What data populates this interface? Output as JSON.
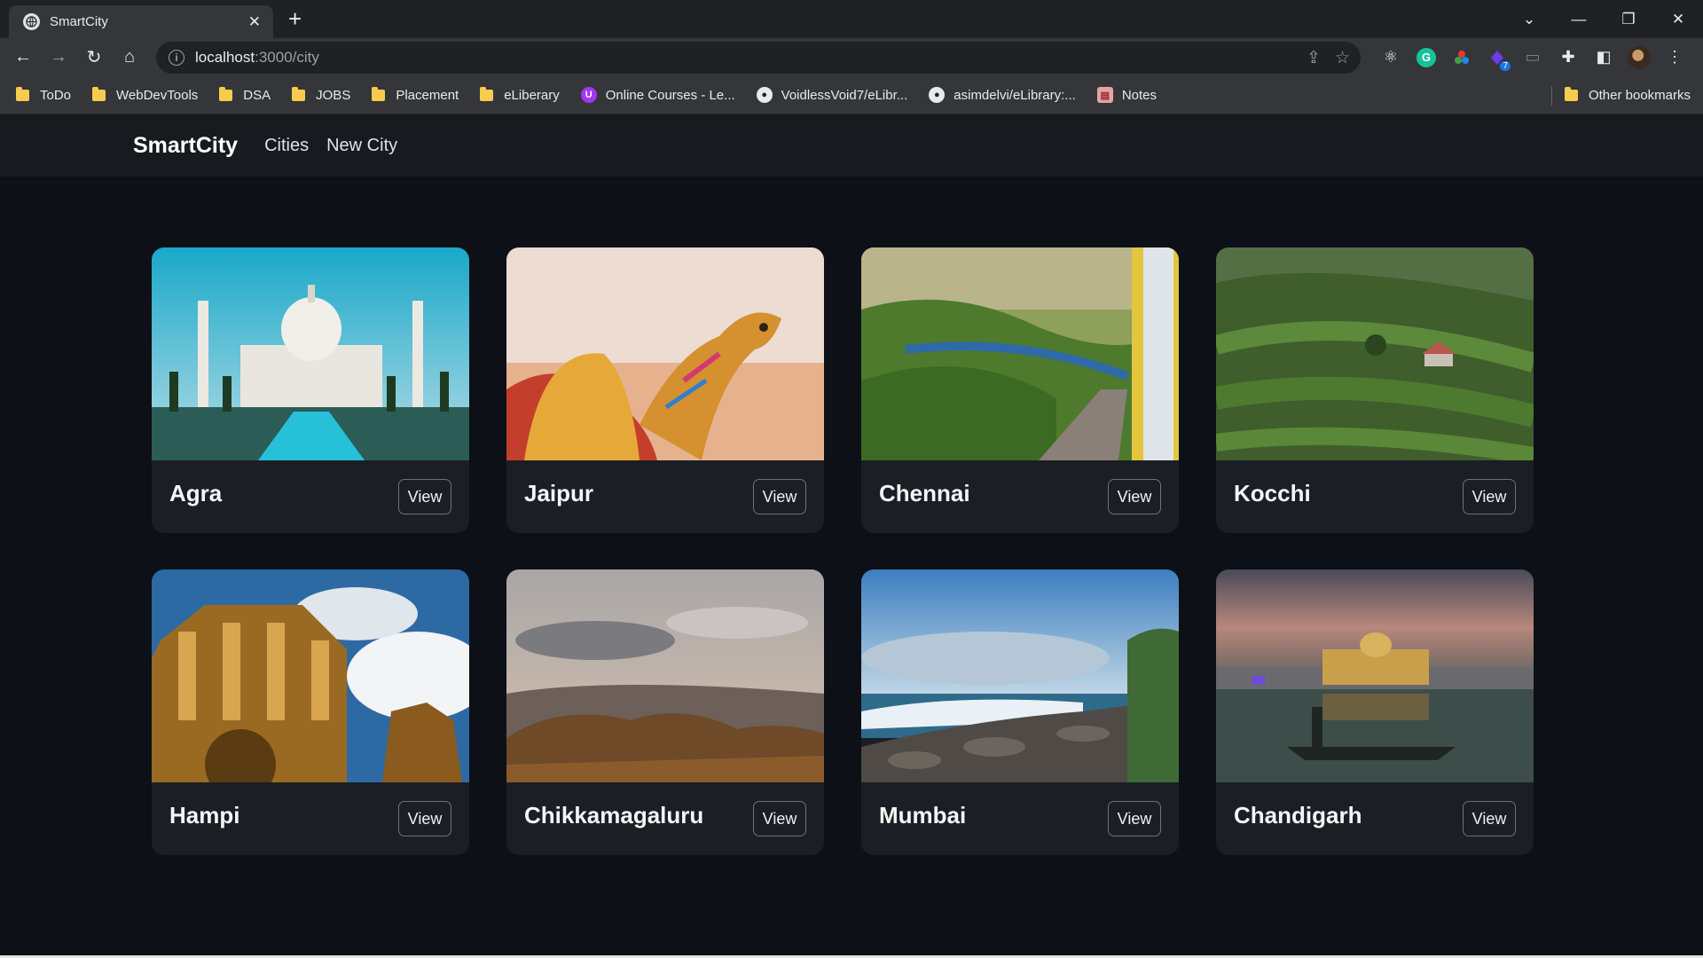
{
  "browser": {
    "tab_title": "SmartCity",
    "url_host": "localhost",
    "url_path": ":3000/city",
    "bookmarks": [
      {
        "label": "ToDo",
        "icon": "folder-icon"
      },
      {
        "label": "WebDevTools",
        "icon": "folder-icon"
      },
      {
        "label": "DSA",
        "icon": "folder-icon"
      },
      {
        "label": "JOBS",
        "icon": "folder-icon"
      },
      {
        "label": "Placement",
        "icon": "folder-icon"
      },
      {
        "label": "eLiberary",
        "icon": "folder-icon"
      },
      {
        "label": "Online Courses - Le...",
        "icon": "udemy-icon"
      },
      {
        "label": "VoidlessVoid7/eLibr...",
        "icon": "github-icon"
      },
      {
        "label": "asimdelvi/eLibrary:...",
        "icon": "github-icon"
      },
      {
        "label": "Notes",
        "icon": "notes-icon"
      }
    ],
    "other_bookmarks": "Other bookmarks",
    "extension_badge": "7"
  },
  "navbar": {
    "brand": "SmartCity",
    "links": [
      "Cities",
      "New City"
    ]
  },
  "cities": [
    {
      "name": "Agra",
      "button": "View",
      "image": "taj-mahal-image"
    },
    {
      "name": "Jaipur",
      "button": "View",
      "image": "camel-desert-image"
    },
    {
      "name": "Chennai",
      "button": "View",
      "image": "train-hills-image"
    },
    {
      "name": "Kocchi",
      "button": "View",
      "image": "tea-plantation-image"
    },
    {
      "name": "Hampi",
      "button": "View",
      "image": "stone-chariot-image"
    },
    {
      "name": "Chikkamagaluru",
      "button": "View",
      "image": "hill-landscape-image"
    },
    {
      "name": "Mumbai",
      "button": "View",
      "image": "rocky-seashore-image"
    },
    {
      "name": "Chandigarh",
      "button": "View",
      "image": "golden-temple-image"
    }
  ]
}
